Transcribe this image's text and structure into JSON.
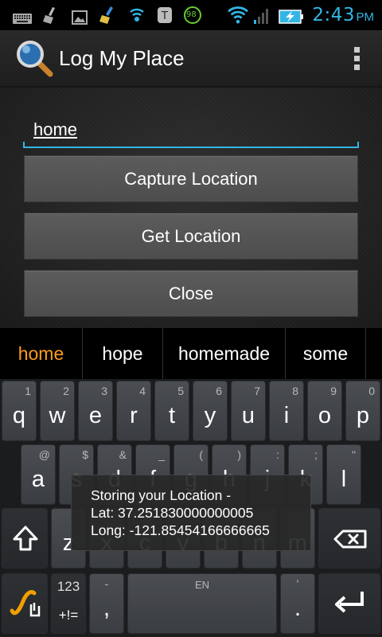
{
  "status_bar": {
    "time": "2:43",
    "ampm": "PM",
    "icons": [
      "keyboard-icon",
      "broom-icon",
      "image-icon",
      "cleaner-icon",
      "wifi-signal-icon",
      "tool-icon",
      "battery-saver-icon",
      "wifi-icon",
      "cell-signal-icon",
      "battery-charging-icon"
    ],
    "battery_saver_badge": "98"
  },
  "action_bar": {
    "title": "Log My Place",
    "app_icon": "magnifier-icon",
    "overflow_icon": "overflow-menu-icon"
  },
  "form": {
    "text_value": "home",
    "buttons": {
      "capture": "Capture Location",
      "get": "Get Location",
      "close": "Close"
    }
  },
  "suggestions": [
    "home",
    "hope",
    "homemade",
    "some"
  ],
  "keyboard": {
    "row1": [
      {
        "ch": "q",
        "alt": "1"
      },
      {
        "ch": "w",
        "alt": "2"
      },
      {
        "ch": "e",
        "alt": "3"
      },
      {
        "ch": "r",
        "alt": "4"
      },
      {
        "ch": "t",
        "alt": "5"
      },
      {
        "ch": "y",
        "alt": "6"
      },
      {
        "ch": "u",
        "alt": "7"
      },
      {
        "ch": "i",
        "alt": "8"
      },
      {
        "ch": "o",
        "alt": "9"
      },
      {
        "ch": "p",
        "alt": "0"
      }
    ],
    "row2": [
      {
        "ch": "a",
        "alt": "@"
      },
      {
        "ch": "s",
        "alt": "$"
      },
      {
        "ch": "d",
        "alt": "&"
      },
      {
        "ch": "f",
        "alt": "_"
      },
      {
        "ch": "g",
        "alt": "("
      },
      {
        "ch": "h",
        "alt": ")"
      },
      {
        "ch": "j",
        "alt": ":"
      },
      {
        "ch": "k",
        "alt": ";"
      },
      {
        "ch": "l",
        "alt": "\""
      }
    ],
    "row3": [
      {
        "ch": "z"
      },
      {
        "ch": "x"
      },
      {
        "ch": "c"
      },
      {
        "ch": "v"
      },
      {
        "ch": "b"
      },
      {
        "ch": "n"
      },
      {
        "ch": "m"
      }
    ],
    "shift_icon": "shift-icon",
    "backspace_icon": "backspace-icon",
    "swype_icon": "swype-gesture-icon",
    "numsym_top": "123",
    "numsym_bottom": "+!=",
    "comma": ",",
    "comma_alt": "-",
    "space_label": "EN",
    "period": ".",
    "period_alt": "'",
    "enter_icon": "enter-icon"
  },
  "toast": {
    "line1": "Storing your Location -",
    "line2": "Lat: 37.251830000000005",
    "line3": "Long: -121.85454166666665"
  },
  "colors": {
    "accent": "#33b5e5",
    "suggestion_primary": "#ff9c1a"
  }
}
